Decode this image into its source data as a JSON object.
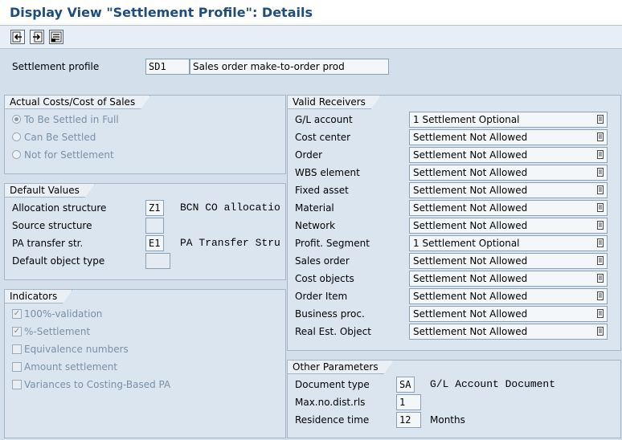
{
  "title": "Display View \"Settlement Profile\": Details",
  "toolbar": {
    "buttons": [
      {
        "icon": "previous-entry-icon"
      },
      {
        "icon": "next-entry-icon"
      },
      {
        "icon": "overview-icon"
      }
    ]
  },
  "header": {
    "settlement_profile_label": "Settlement profile",
    "settlement_profile_code": "SD1",
    "settlement_profile_text": "Sales order make-to-order prod"
  },
  "actual_costs": {
    "title": "Actual Costs/Cost of Sales",
    "options": [
      {
        "label": "To Be Settled in Full",
        "selected": true
      },
      {
        "label": "Can Be Settled",
        "selected": false
      },
      {
        "label": "Not for Settlement",
        "selected": false
      }
    ]
  },
  "default_values": {
    "title": "Default Values",
    "allocation_structure_label": "Allocation structure",
    "allocation_structure_code": "Z1",
    "allocation_structure_text": "BCN CO allocatio",
    "source_structure_label": "Source structure",
    "pa_transfer_label": "PA transfer str.",
    "pa_transfer_code": "E1",
    "pa_transfer_text": "PA Transfer Stru",
    "default_object_type_label": "Default object type"
  },
  "indicators": {
    "title": "Indicators",
    "items": [
      {
        "label": "100%-validation",
        "checked": true
      },
      {
        "label": "%-Settlement",
        "checked": true
      },
      {
        "label": "Equivalence numbers",
        "checked": false
      },
      {
        "label": "Amount settlement",
        "checked": false
      },
      {
        "label": "Variances to Costing-Based PA",
        "checked": false
      }
    ]
  },
  "valid_receivers": {
    "title": "Valid Receivers",
    "rows": [
      {
        "label": "G/L account",
        "value": "1 Settlement Optional"
      },
      {
        "label": "Cost center",
        "value": "Settlement Not Allowed"
      },
      {
        "label": "Order",
        "value": "Settlement Not Allowed"
      },
      {
        "label": "WBS element",
        "value": "Settlement Not Allowed"
      },
      {
        "label": "Fixed asset",
        "value": "Settlement Not Allowed"
      },
      {
        "label": "Material",
        "value": "Settlement Not Allowed"
      },
      {
        "label": "Network",
        "value": "Settlement Not Allowed"
      },
      {
        "label": "Profit. Segment",
        "value": "1 Settlement Optional"
      },
      {
        "label": "Sales order",
        "value": "Settlement Not Allowed"
      },
      {
        "label": "Cost objects",
        "value": "Settlement Not Allowed"
      },
      {
        "label": "Order Item",
        "value": "Settlement Not Allowed"
      },
      {
        "label": "Business proc.",
        "value": "Settlement Not Allowed"
      },
      {
        "label": "Real Est. Object",
        "value": "Settlement Not Allowed"
      }
    ]
  },
  "other_parameters": {
    "title": "Other Parameters",
    "document_type_label": "Document type",
    "document_type_code": "SA",
    "document_type_text": "G/L Account Document",
    "max_dist_label": "Max.no.dist.rls",
    "max_dist_value": "1",
    "residence_time_label": "Residence time",
    "residence_time_value": "12",
    "residence_time_unit": "Months"
  }
}
